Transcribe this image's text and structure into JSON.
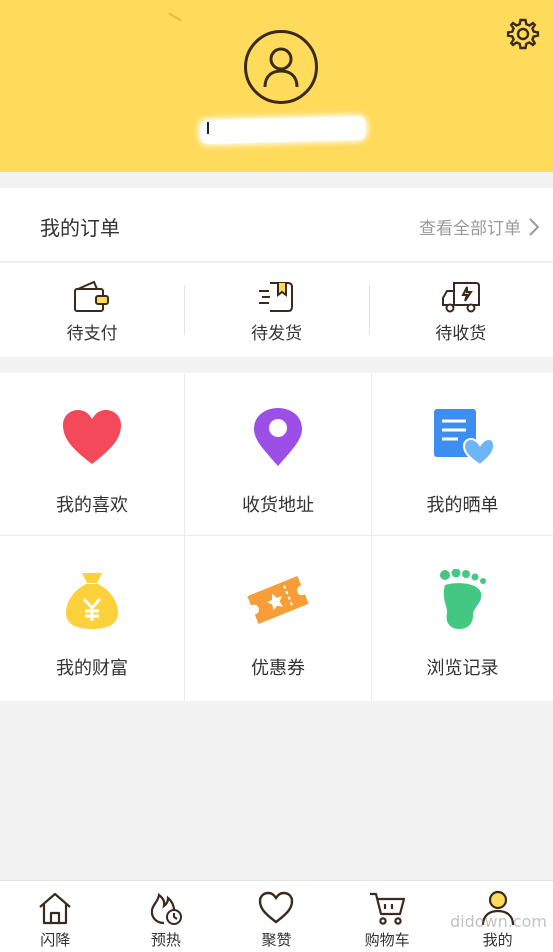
{
  "orders": {
    "title": "我的订单",
    "view_all": "查看全部订单",
    "items": [
      {
        "label": "待支付",
        "icon": "wallet-icon"
      },
      {
        "label": "待发货",
        "icon": "ship-box-icon"
      },
      {
        "label": "待收货",
        "icon": "delivery-truck-icon"
      }
    ]
  },
  "features": [
    {
      "label": "我的喜欢",
      "icon": "heart-icon",
      "color": "#f4495b"
    },
    {
      "label": "收货地址",
      "icon": "location-pin-icon",
      "color": "#9b4fe6"
    },
    {
      "label": "我的晒单",
      "icon": "document-heart-icon",
      "color": "#3d8ef0"
    },
    {
      "label": "我的财富",
      "icon": "money-bag-icon",
      "color": "#fdd13c"
    },
    {
      "label": "优惠券",
      "icon": "coupon-icon",
      "color": "#f89e38"
    },
    {
      "label": "浏览记录",
      "icon": "footprint-icon",
      "color": "#43c783"
    }
  ],
  "tabbar": [
    {
      "label": "闪降",
      "icon": "home-icon"
    },
    {
      "label": "预热",
      "icon": "flame-clock-icon"
    },
    {
      "label": "聚赞",
      "icon": "heart-outline-icon"
    },
    {
      "label": "购物车",
      "icon": "cart-icon"
    },
    {
      "label": "我的",
      "icon": "user-icon",
      "active": true
    }
  ],
  "watermark": "didown.com",
  "colors": {
    "header_bg": "#fedb5a",
    "icon_dark": "#3a2a1e"
  }
}
